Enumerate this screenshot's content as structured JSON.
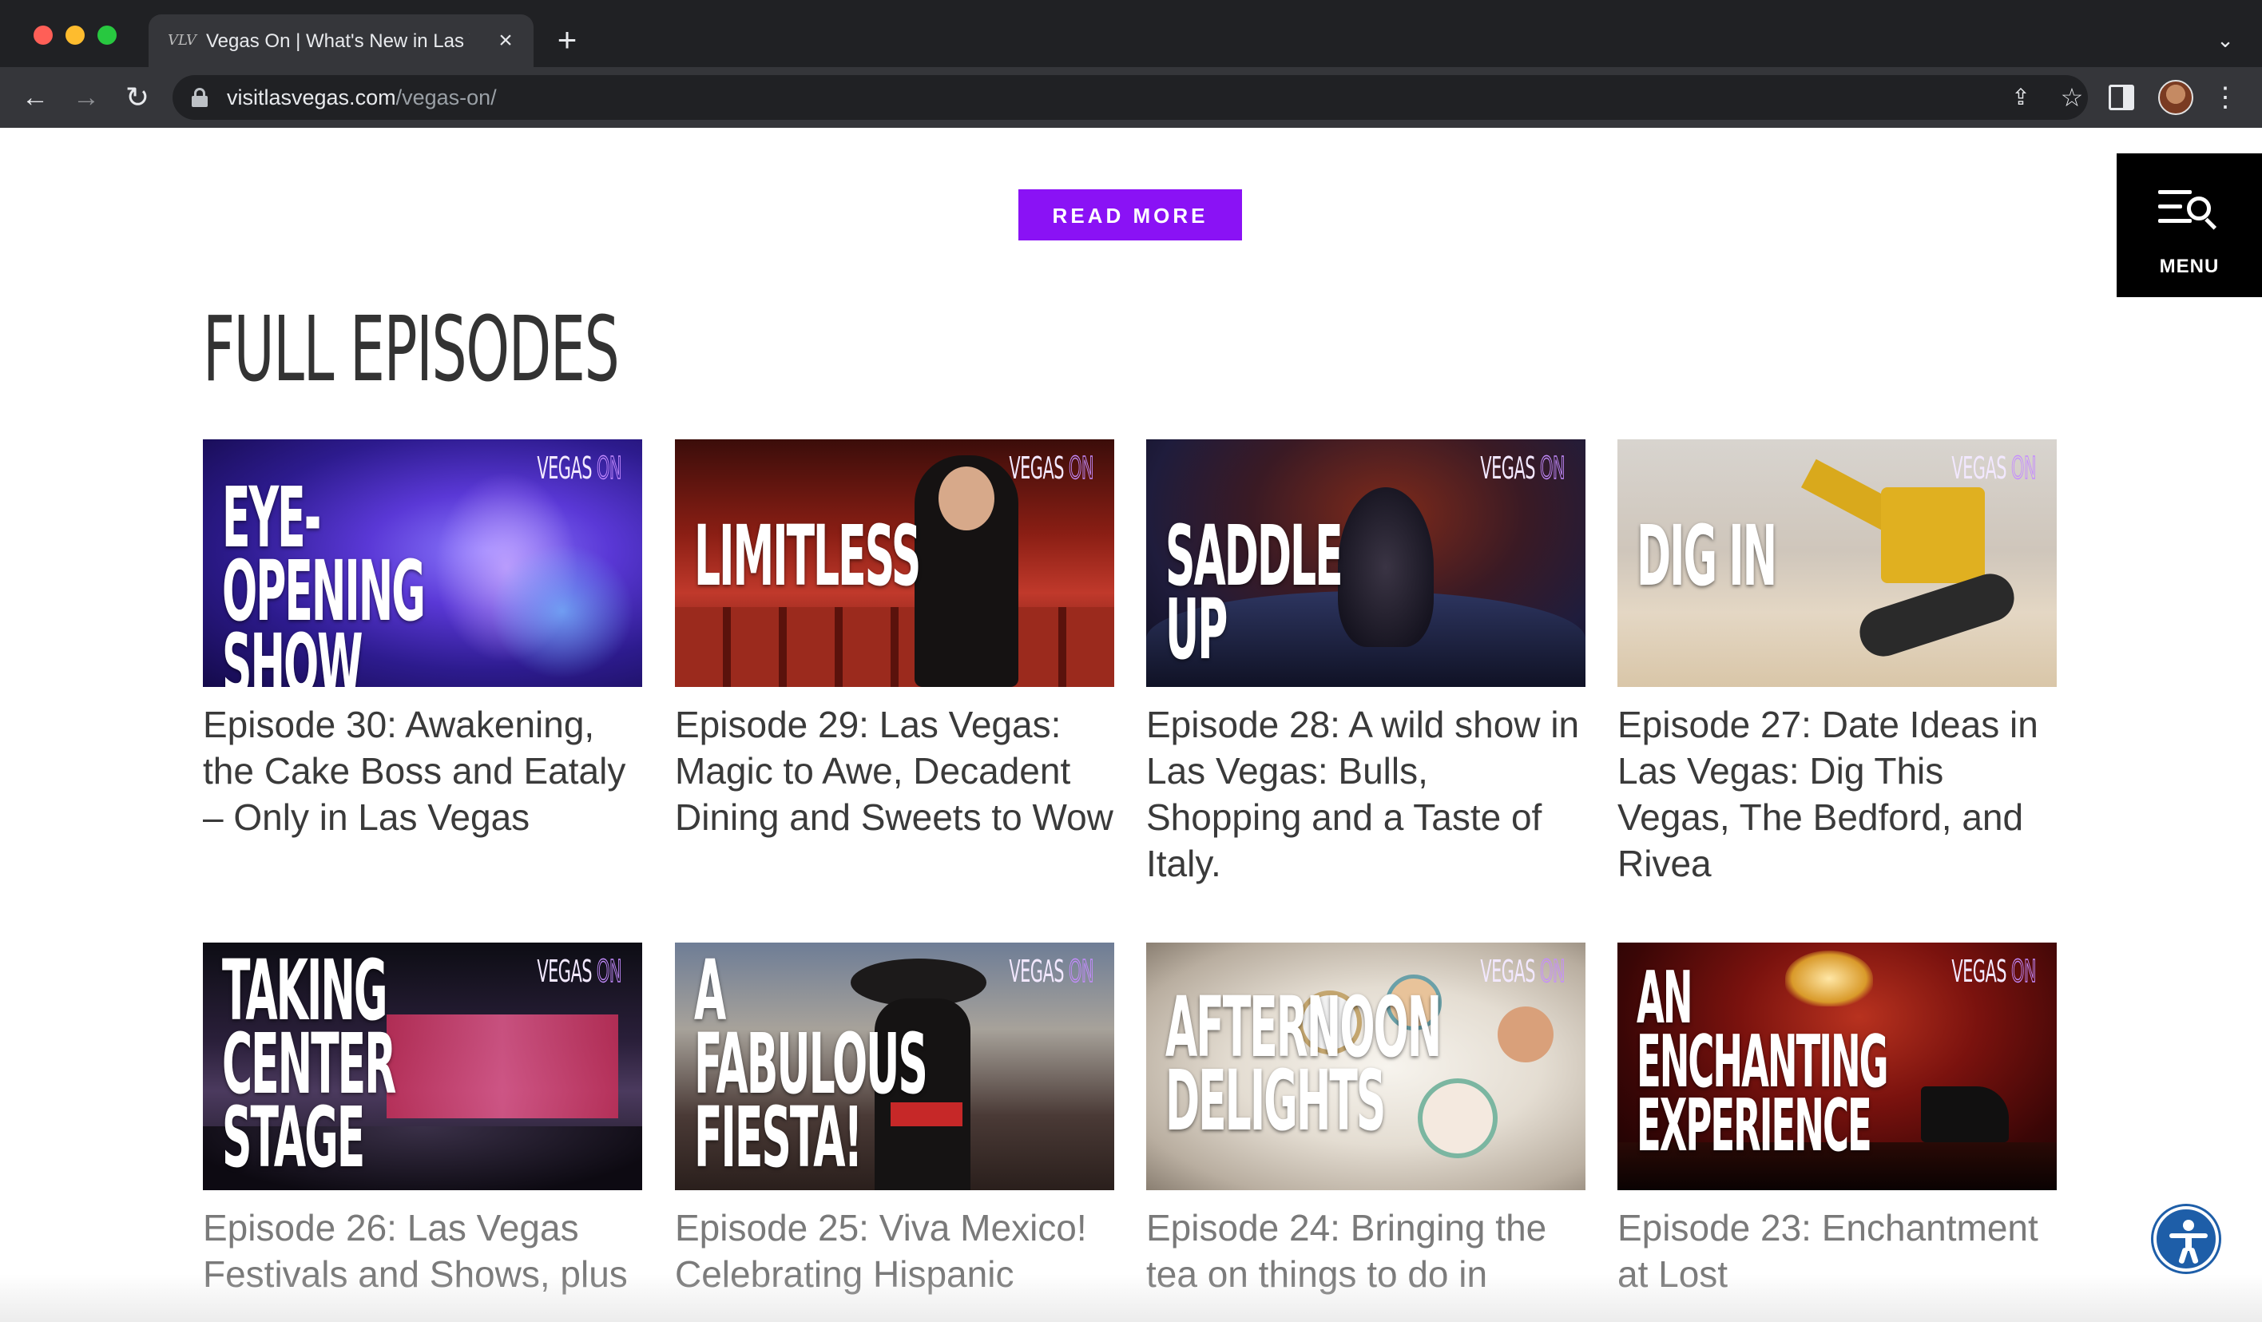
{
  "browser": {
    "tab": {
      "title": "Vegas On | What's New in Las Vegas",
      "favicon": "VLV",
      "close_icon": "×"
    },
    "new_tab_icon": "+",
    "tab_list_icon": "⌄",
    "nav": {
      "back": "←",
      "forward": "→",
      "reload": "↻"
    },
    "url": {
      "host": "visitlasvegas.com",
      "path": "/vegas-on/"
    },
    "share_icon": "⇪",
    "star_icon": "☆",
    "menu_icon": "⋮"
  },
  "page": {
    "read_more_label": "READ MORE",
    "menu_label": "MENU",
    "section_title": "FULL EPISODES",
    "brand_word_1": "VEGAS",
    "brand_word_2": "ON",
    "episodes": [
      {
        "headline": "EYE-OPENING\nSHOW",
        "title": "Episode 30: Awakening, the Cake Boss and Eataly – Only in Las Vegas"
      },
      {
        "headline": "LIMITLESS",
        "title": "Episode 29: Las Vegas: Magic to Awe, Decadent Dining and Sweets to Wow"
      },
      {
        "headline": "SADDLE UP",
        "title": "Episode 28: A wild show in Las Vegas: Bulls, Shopping and a Taste of Italy."
      },
      {
        "headline": "DIG IN",
        "title": "Episode 27: Date Ideas in Las Vegas: Dig This Vegas, The Bedford, and Rivea"
      },
      {
        "headline": "TAKING\nCENTER\nSTAGE",
        "title": "Episode 26: Las Vegas Festivals and Shows, plus"
      },
      {
        "headline": "A\nFABULOUS\nFIESTA!",
        "title": "Episode 25: Viva Mexico! Celebrating Hispanic"
      },
      {
        "headline": "AFTERNOON\nDELIGHTS",
        "title": "Episode 24: Bringing the tea on things to do in"
      },
      {
        "headline": "AN\nENCHANTING\nEXPERIENCE",
        "title": "Episode 23: Enchantment at Lost"
      }
    ]
  },
  "colors": {
    "accent_purple": "#8a12f5",
    "menu_bg": "#000000",
    "accessibility_blue": "#1e5ea8"
  }
}
